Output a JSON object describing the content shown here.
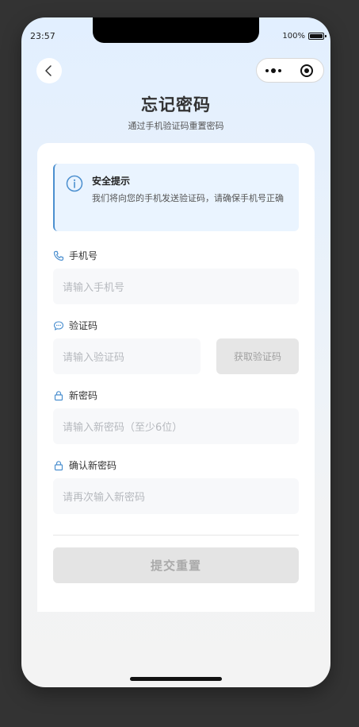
{
  "status": {
    "time": "23:57",
    "battery": "100%"
  },
  "header": {
    "title": "忘记密码",
    "subtitle": "通过手机验证码重置密码"
  },
  "notice": {
    "title": "安全提示",
    "text": "我们将向您的手机发送验证码，请确保手机号正确"
  },
  "form": {
    "phone": {
      "label": "手机号",
      "placeholder": "请输入手机号",
      "icon": "phone-icon"
    },
    "code": {
      "label": "验证码",
      "placeholder": "请输入验证码",
      "button": "获取验证码",
      "icon": "chat-icon"
    },
    "new_password": {
      "label": "新密码",
      "placeholder": "请输入新密码（至少6位）",
      "icon": "lock-icon"
    },
    "confirm_password": {
      "label": "确认新密码",
      "placeholder": "请再次输入新密码",
      "icon": "lock-icon"
    },
    "submit": "提交重置"
  },
  "colors": {
    "accent": "#4b8fcf",
    "notice_bg": "#eaf4ff",
    "disabled_bg": "#e4e4e4"
  }
}
